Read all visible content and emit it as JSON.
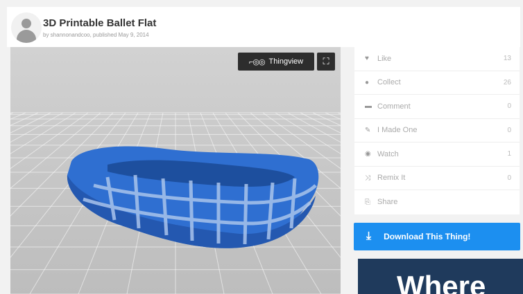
{
  "header": {
    "title": "3D Printable Ballet Flat",
    "byline": "by shannonandcoo, published May 9, 2014"
  },
  "viewer": {
    "thingview_label": "Thingview",
    "glasses_glyph": "⌐◎◎",
    "expand_glyph": "⛶"
  },
  "actions": [
    {
      "icon": "♥",
      "label": "Like",
      "count": "13"
    },
    {
      "icon": "●",
      "label": "Collect",
      "count": "26"
    },
    {
      "icon": "▬",
      "label": "Comment",
      "count": "0"
    },
    {
      "icon": "✎",
      "label": "I Made One",
      "count": "0"
    },
    {
      "icon": "◉",
      "label": "Watch",
      "count": "1"
    },
    {
      "icon": "⤨",
      "label": "Remix It",
      "count": "0"
    },
    {
      "icon": "⎘",
      "label": "Share",
      "count": ""
    }
  ],
  "download": {
    "label": "Download This Thing!",
    "icon": "⤓"
  },
  "ad": {
    "text": "Where"
  },
  "colors": {
    "accent": "#1c8ff0",
    "model": "#2f6fd1",
    "toolbar": "#2d2d2d"
  }
}
